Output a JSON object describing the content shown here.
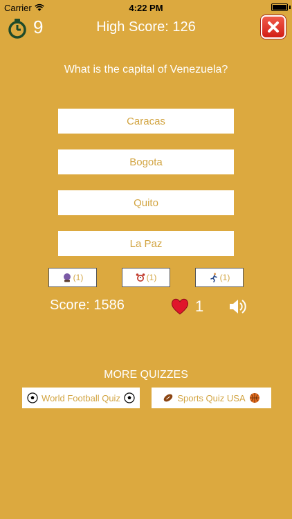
{
  "status_bar": {
    "carrier": "Carrier",
    "time": "4:22 PM"
  },
  "header": {
    "timer_value": "9",
    "high_score": "High Score: 126"
  },
  "question": "What is the capital of Venezuela?",
  "answers": [
    "Caracas",
    "Bogota",
    "Quito",
    "La Paz"
  ],
  "lifelines": [
    {
      "icon": "crystal-ball-icon",
      "count": "(1)"
    },
    {
      "icon": "alarm-clock-icon",
      "count": "(1)"
    },
    {
      "icon": "running-person-icon",
      "count": "(1)"
    }
  ],
  "status": {
    "score": "Score: 1586",
    "lives": "1"
  },
  "more": {
    "title": "MORE QUIZZES",
    "links": [
      {
        "label": "World Football Quiz",
        "icons": [
          "soccer-ball-icon",
          "soccer-ball-icon"
        ]
      },
      {
        "label": "Sports Quiz USA",
        "icons": [
          "american-football-icon",
          "basketball-icon"
        ]
      }
    ]
  },
  "colors": {
    "background": "#DCA93F",
    "answer_text": "#D2A441",
    "close_button": "#D9261C",
    "heart": "#E0162B"
  }
}
